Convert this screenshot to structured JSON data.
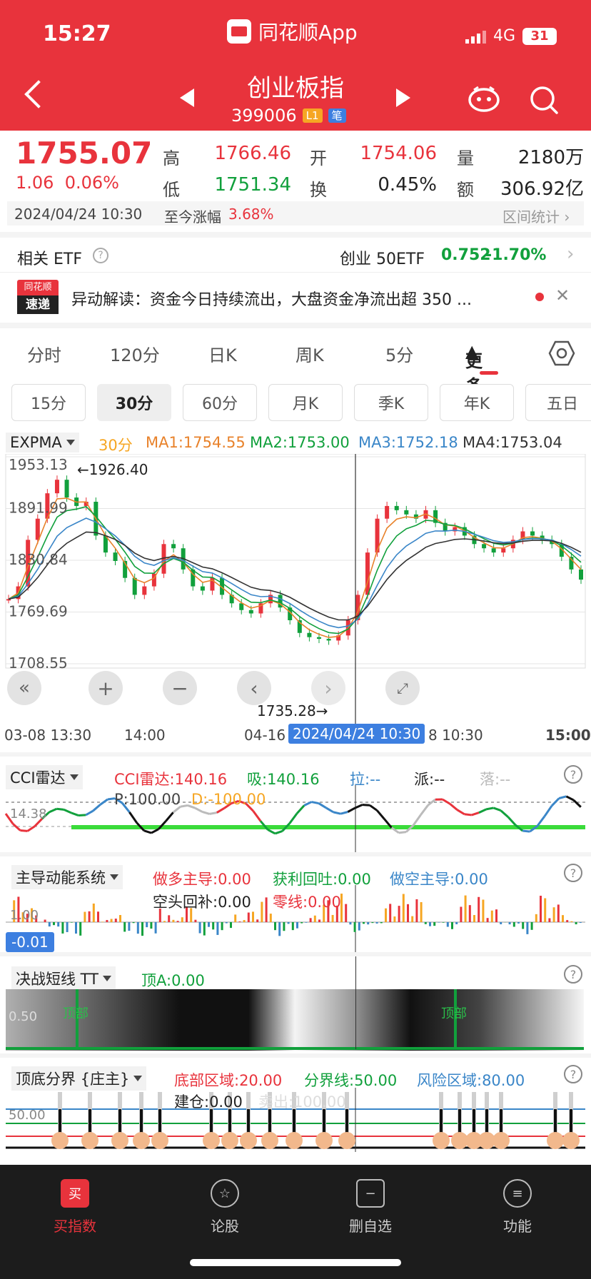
{
  "status": {
    "time": "15:27",
    "app_name": "同花顺App",
    "network": "4G",
    "battery": "31"
  },
  "nav": {
    "title": "创业板指",
    "code": "399006",
    "tag_l1": "L1",
    "tag_bi": "笔"
  },
  "quote": {
    "price": "1755.07",
    "change": "1.06",
    "change_pct": "0.06%",
    "high_label": "高",
    "high": "1766.46",
    "open_label": "开",
    "open": "1754.06",
    "volume_label": "量",
    "volume": "2180万",
    "low_label": "低",
    "low": "1751.34",
    "turnover_label": "换",
    "turnover": "0.45%",
    "amount_label": "额",
    "amount": "306.92亿",
    "datetime": "2024/04/24 10:30",
    "since_label": "至今涨幅",
    "since_value": "3.68%",
    "range_stats": "区间统计"
  },
  "etf": {
    "label": "相关 ETF",
    "name": "创业 50ETF",
    "price": "0.752",
    "pct": "-1.70%"
  },
  "news": {
    "badge_top": "同花顺",
    "badge_bottom": "速递",
    "text": "异动解读：资金今日持续流出，大盘资金净流出超 350 ..."
  },
  "period_tabs": [
    "分时",
    "120分",
    "日K",
    "周K",
    "5分",
    "更多"
  ],
  "k_tabs": [
    "15分",
    "30分",
    "60分",
    "月K",
    "季K",
    "年K",
    "五日"
  ],
  "main_chart": {
    "indicator": "EXPMA",
    "period": "30分",
    "ma1": "MA1:1754.55",
    "ma2": "MA2:1753.00",
    "ma3": "MA3:1752.18",
    "ma4": "MA4:1753.04",
    "y_labels": [
      "1953.13",
      "1891.99",
      "1830.84",
      "1769.69",
      "1708.55"
    ],
    "high_mark": "←1926.40",
    "low_mark": "1735.28→",
    "x_labels": [
      "03-08 13:30",
      "14:00",
      "04-16",
      "2024/04/24 10:30",
      "8 10:30",
      "15:00"
    ],
    "colors": {
      "ma1": "#e8822b",
      "ma2": "#11a03c",
      "ma3": "#3a86c8",
      "ma4": "#333333",
      "up": "#e8333c",
      "down": "#11a03c"
    }
  },
  "chart_data": {
    "type": "line",
    "title": "",
    "ylim": [
      1708.55,
      1953.13
    ],
    "x": [
      "03-08 13:30",
      "14:00",
      "04-16",
      "2024/04/24 10:30",
      "8 10:30",
      "15:00"
    ],
    "series": [
      {
        "values": [
          1785,
          1800,
          1855,
          1880,
          1910,
          1926,
          1905,
          1895,
          1900,
          1860,
          1840,
          1830,
          1810,
          1790,
          1800,
          1815,
          1850,
          1845,
          1820,
          1800,
          1795,
          1810,
          1790,
          1780,
          1772,
          1768,
          1780,
          1790,
          1775,
          1760,
          1745,
          1740,
          1738,
          1736,
          1742,
          1760,
          1790,
          1840,
          1880,
          1895,
          1890,
          1885,
          1880,
          1890,
          1875,
          1865,
          1870,
          1860,
          1850,
          1845,
          1840,
          1845,
          1855,
          1865,
          1860,
          1855,
          1850,
          1835,
          1820,
          1808
        ]
      }
    ]
  },
  "cci": {
    "name": "CCI雷达",
    "value": "CCI雷达:140.16",
    "xi": "吸:140.16",
    "la": "拉:--",
    "pai": "派:--",
    "luo": "落:--",
    "p": "P:100.00",
    "d": "D:-100.00",
    "y_label": "14.38"
  },
  "zhudao": {
    "name": "主导动能系统",
    "a": "做多主导:0.00",
    "b": "获利回吐:0.00",
    "c": "做空主导:0.00",
    "d": "空头回补:0.00",
    "e": "零线:0.00",
    "y_label": "1.00",
    "value_badge": "-0.01"
  },
  "juezhan": {
    "name": "决战短线 TT",
    "a": "顶A:0.00",
    "y_label": "0.50",
    "tag1": "顶部",
    "tag2": "顶部"
  },
  "dingdi": {
    "name": "顶底分界 {庄主}",
    "a": "底部区域:20.00",
    "b": "分界线:50.00",
    "c": "风险区域:80.00",
    "d": "建仓:0.00",
    "e": "卖出:100.00",
    "y_label": "50.00"
  },
  "bottom_nav": [
    "买指数",
    "论股",
    "删自选",
    "功能"
  ]
}
